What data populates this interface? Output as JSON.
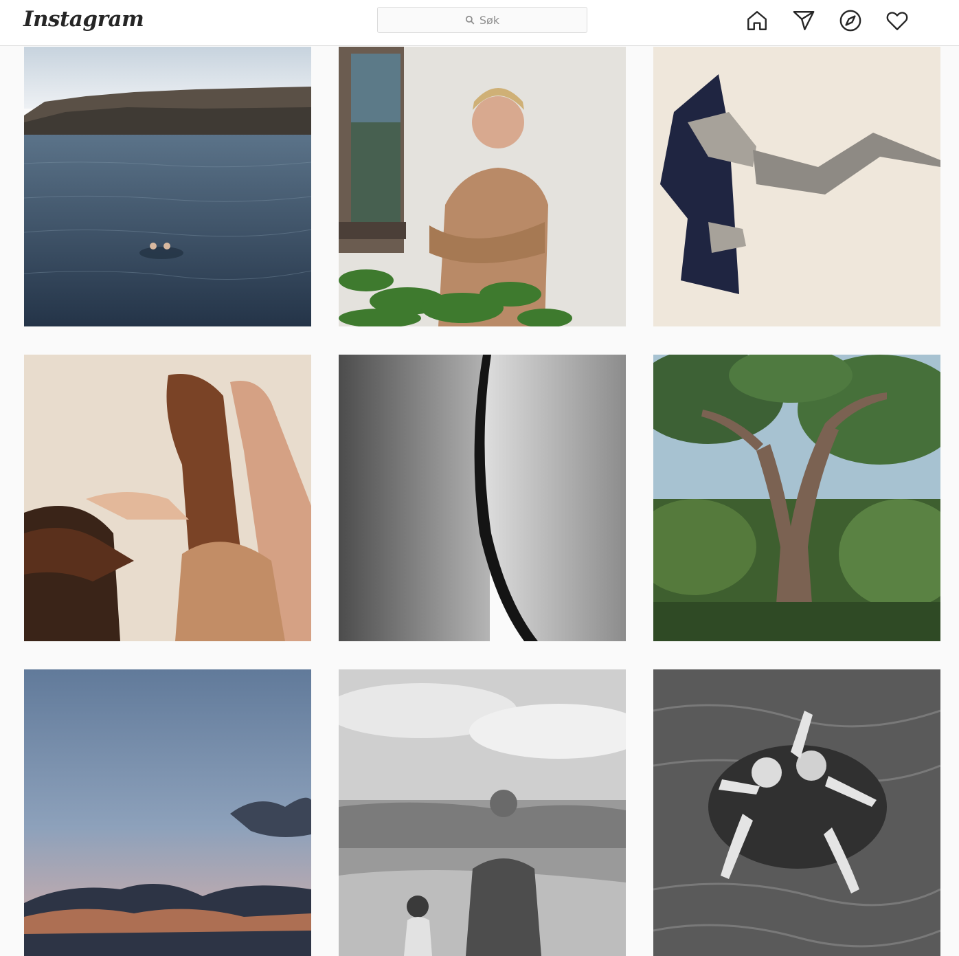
{
  "header": {
    "logo_text": "Instagram",
    "search": {
      "placeholder": "Søk"
    },
    "nav_icons": [
      "home-icon",
      "direct-send-icon",
      "explore-compass-icon",
      "activity-heart-icon"
    ]
  },
  "feed": {
    "posts": [
      {
        "subject": "swimmers-lake"
      },
      {
        "subject": "woman-beige-sweater"
      },
      {
        "subject": "collage-hand-jacket"
      },
      {
        "subject": "raised-arms"
      },
      {
        "subject": "bw-skin-closeup"
      },
      {
        "subject": "pine-tree-forest"
      },
      {
        "subject": "sunset-sky"
      },
      {
        "subject": "bw-rocky-coast"
      },
      {
        "subject": "bw-swimmers"
      }
    ]
  },
  "colors": {
    "header_bg": "#ffffff",
    "page_bg": "#fafafa",
    "border": "#dbdbdb",
    "icon": "#262626",
    "placeholder": "#8e8e8e"
  }
}
